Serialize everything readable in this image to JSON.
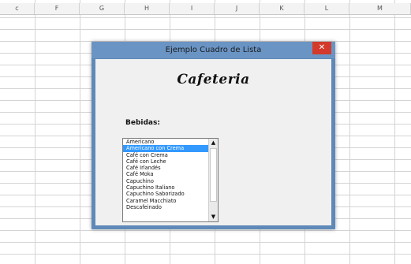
{
  "spreadsheet": {
    "columns": [
      "c",
      "F",
      "G",
      "H",
      "I",
      "J",
      "K",
      "L",
      "M"
    ]
  },
  "dialog": {
    "title": "Ejemplo Cuadro de Lista",
    "close_label": "✕",
    "logo_text": "Cafeteria",
    "list_label": "Bebidas:",
    "list_items": [
      "Americano",
      "Americano con Crema",
      "Café con Crema",
      "Café con Leche",
      "Café Irlandés",
      "Café Moka",
      "Capuchino",
      "Capuchino Italiano",
      "Capuchino Saborizado",
      "Caramel Macchiato",
      "Descafeinado"
    ],
    "selected_item": "Americano con Crema",
    "scroll_up": "▲",
    "scroll_down": "▼"
  },
  "colors": {
    "titlebar": "#6a94c4",
    "close_button": "#d33a2c",
    "selection": "#3399ff"
  }
}
